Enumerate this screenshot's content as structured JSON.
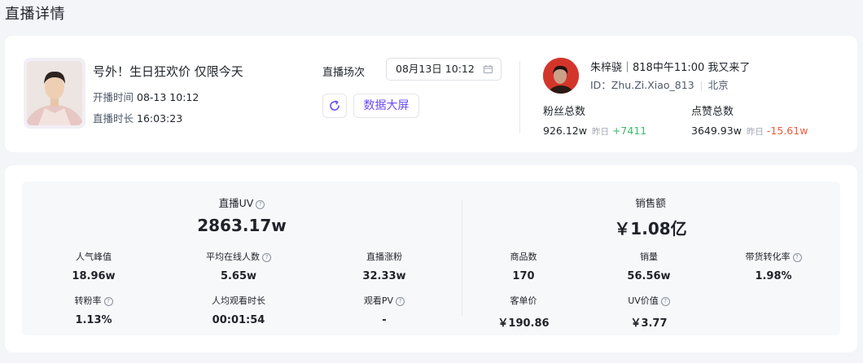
{
  "page": {
    "title": "直播详情"
  },
  "live": {
    "title": "号外！生日狂欢价 仅限今天",
    "start_label": "开播时间",
    "start_value": "08-13 10:12",
    "duration_label": "直播时长",
    "duration_value": "16:03:23"
  },
  "session": {
    "label": "直播场次",
    "value": "08月13日 10:12",
    "big_screen_label": "数据大屏"
  },
  "anchor": {
    "name": "朱梓骁｜818中午11:00 我又来了",
    "id_text": "ID：Zhu.Zi.Xiao_813",
    "location": "北京",
    "fans_label": "粉丝总数",
    "fans_value": "926.12w",
    "fans_yesterday_label": "昨日",
    "fans_delta": "+7411",
    "likes_label": "点赞总数",
    "likes_value": "3649.93w",
    "likes_yesterday_label": "昨日",
    "likes_delta": "-15.61w"
  },
  "metrics": {
    "uv_label": "直播UV",
    "uv_value": "2863.17w",
    "sales_label": "销售额",
    "sales_value": "￥1.08亿",
    "left": [
      {
        "label": "人气峰值",
        "value": "18.96w",
        "help": false
      },
      {
        "label": "平均在线人数",
        "value": "5.65w",
        "help": true
      },
      {
        "label": "直播涨粉",
        "value": "32.33w",
        "help": false
      },
      {
        "label": "转粉率",
        "value": "1.13%",
        "help": true
      },
      {
        "label": "人均观看时长",
        "value": "00:01:54",
        "help": false
      },
      {
        "label": "观看PV",
        "value": "-",
        "help": true
      }
    ],
    "right": [
      {
        "label": "商品数",
        "value": "170",
        "help": false
      },
      {
        "label": "销量",
        "value": "56.56w",
        "help": false
      },
      {
        "label": "带货转化率",
        "value": "1.98%",
        "help": true
      },
      {
        "label": "客单价",
        "value": "￥190.86",
        "help": false
      },
      {
        "label": "UV价值",
        "value": "￥3.77",
        "help": true
      }
    ]
  },
  "colors": {
    "accent": "#6b4cf5",
    "up": "#3dbb6a",
    "down": "#ef5a3c"
  }
}
